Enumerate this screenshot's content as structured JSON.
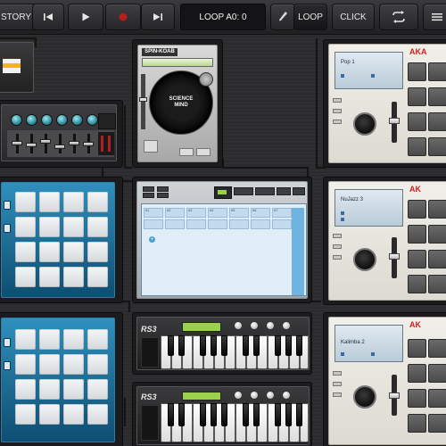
{
  "toolbar": {
    "history_label": "STORY",
    "loop_display": "LOOP A0: 0",
    "loop_label": "LOOP",
    "click_label": "CLICK"
  },
  "spin_deck": {
    "logo": "SPIN-KOAB",
    "disc_title": "SCIENCE MIND"
  },
  "mpc_units": [
    {
      "brand": "AKA",
      "program": "Pop 1"
    },
    {
      "brand": "AK",
      "program": "NuJazz 3"
    },
    {
      "brand": "AK",
      "program": "Kalimba 2"
    }
  ],
  "keyboards": [
    {
      "label": "RS3"
    },
    {
      "label": "RS3"
    }
  ],
  "sequencer": {
    "header_cells": [
      "A1",
      "A2",
      "A3",
      "A4",
      "A5",
      "A6",
      "A7"
    ]
  },
  "icons": {
    "rewind": "skip-back-icon",
    "play": "play-icon",
    "record": "record-icon",
    "forward": "skip-forward-icon",
    "pencil": "pencil-icon",
    "loop_arrows": "loop-arrows-icon",
    "menu": "menu-icon"
  },
  "colors": {
    "pad_blue": "#1a6f9a",
    "mpc_red": "#cc2020",
    "record_red": "#b1201f",
    "lcd_green": "#9bd14a"
  }
}
